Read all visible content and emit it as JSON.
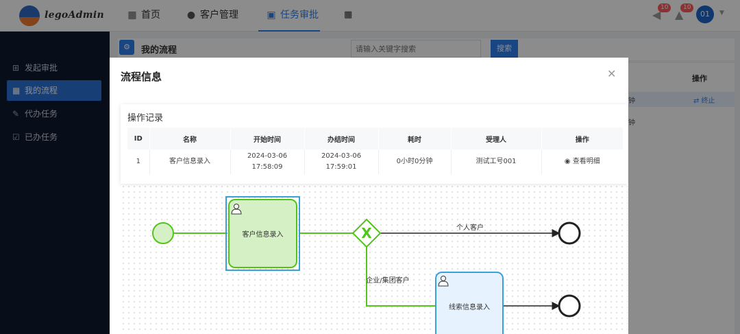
{
  "app": {
    "logo_text": "legoAdmin"
  },
  "nav": [
    {
      "icon": "home-icon",
      "glyph": "▦",
      "label": "首页"
    },
    {
      "icon": "users-icon",
      "glyph": "●",
      "label": "客户管理"
    },
    {
      "icon": "briefcase-icon",
      "glyph": "▣",
      "label": "任务审批"
    }
  ],
  "header_right": {
    "speaker_badge": "10",
    "bell_badge": "10",
    "avatar": "01"
  },
  "sidebar": [
    {
      "icon": "plus-square-icon",
      "glyph": "⊞",
      "label": "发起审批"
    },
    {
      "icon": "dashboard-icon",
      "glyph": "▦",
      "label": "我的流程"
    },
    {
      "icon": "edit-icon",
      "glyph": "✎",
      "label": "代办任务"
    },
    {
      "icon": "check-square-icon",
      "glyph": "☑",
      "label": "已办任务"
    }
  ],
  "content": {
    "title": "我的流程",
    "search_placeholder": "请输入关键字搜索",
    "search_button": "搜索",
    "table_op_header": "操作",
    "row1_fragment": "钟",
    "row1_action": "⇄ 终止",
    "row2_fragment": "钟"
  },
  "modal": {
    "title": "流程信息",
    "close": "✕",
    "record_title": "操作记录",
    "columns": [
      "ID",
      "名称",
      "开始时间",
      "办结时间",
      "耗时",
      "受理人",
      "操作"
    ],
    "rows": [
      {
        "id": "1",
        "name": "客户信息录入",
        "start": "2024-03-06 17:58:09",
        "end": "2024-03-06 17:59:01",
        "duration": "0小时0分钟",
        "assignee": "测试工号001",
        "action": "◉ 查看明细"
      }
    ]
  },
  "diagram": {
    "task1": "客户信息录入",
    "task2": "线索信息录入",
    "flow_personal": "个人客户",
    "flow_enterprise": "企业/集团客户",
    "gateway_symbol": "X"
  }
}
